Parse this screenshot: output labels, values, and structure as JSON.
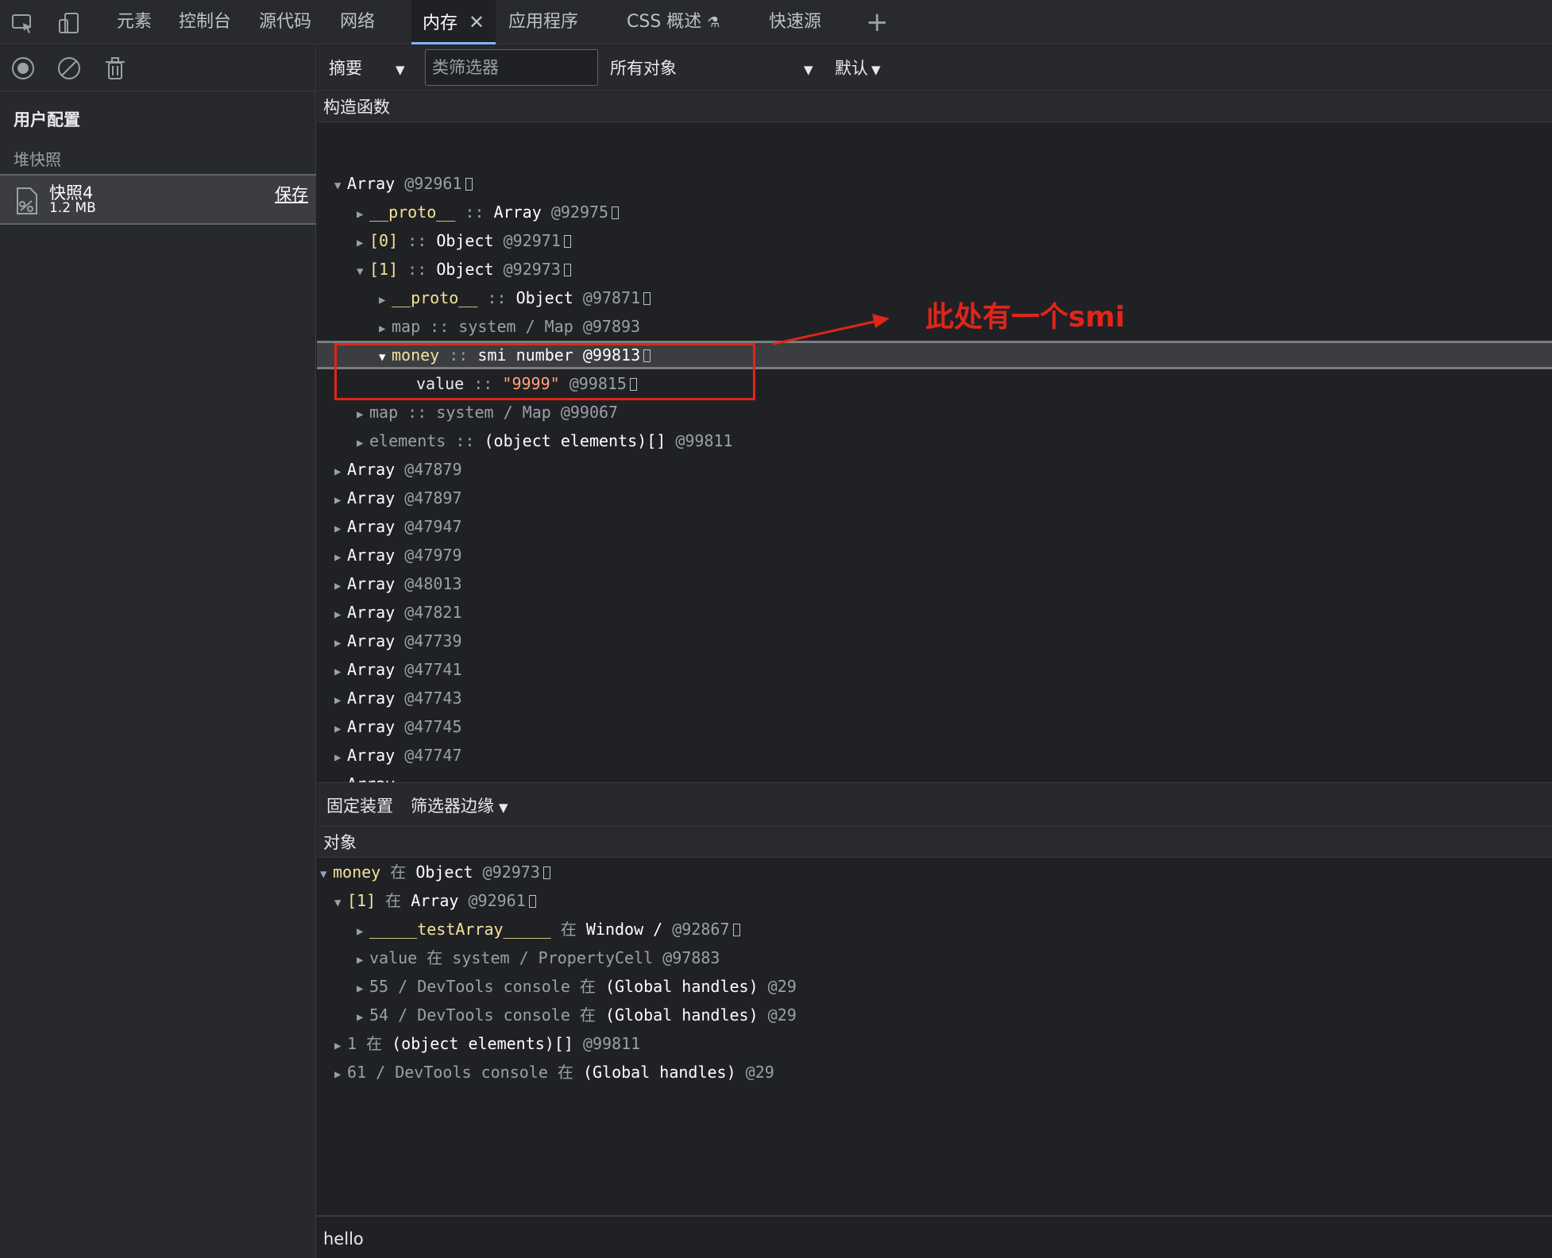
{
  "tabs": {
    "items": [
      "元素",
      "控制台",
      "源代码",
      "网络",
      "内存",
      "应用程序",
      "CSS 概述",
      "快速源"
    ],
    "active_index": 4,
    "close_glyph": "✕",
    "add_glyph": "+"
  },
  "sidebar": {
    "profiles_title": "用户配置",
    "heap_title": "堆快照",
    "snapshot_name": "快照4",
    "snapshot_size": "1.2 MB",
    "save_label": "保存"
  },
  "toolbar": {
    "view_label": "摘要",
    "class_filter_placeholder": "类筛选器",
    "objects_label": "所有对象",
    "default_label": "默认"
  },
  "constructors_header": "构造函数",
  "tree": {
    "array_root": {
      "name": "Array",
      "id": "@92961"
    },
    "proto": {
      "name": "__proto__",
      "sep": "::",
      "type": "Array",
      "id": "@92975"
    },
    "item0": {
      "name": "[0]",
      "sep": "::",
      "type": "Object",
      "id": "@92971"
    },
    "item1": {
      "name": "[1]",
      "sep": "::",
      "type": "Object",
      "id": "@92973"
    },
    "item1_proto": {
      "name": "__proto__",
      "sep": "::",
      "type": "Object",
      "id": "@97871"
    },
    "item1_map": {
      "text": "map :: system / Map",
      "id": "@97893"
    },
    "money": {
      "name": "money",
      "sep": "::",
      "type": "smi number",
      "id": "@99813"
    },
    "value": {
      "name": "value",
      "sep": "::",
      "val": "\"9999\"",
      "id": "@99815"
    },
    "map2": {
      "text": "map :: system / Map",
      "id": "@99067"
    },
    "elements": {
      "name": "elements",
      "sep": "::",
      "type": "(object elements)[]",
      "id": "@99811"
    },
    "arrays": [
      {
        "name": "Array",
        "id": "@47879"
      },
      {
        "name": "Array",
        "id": "@47897"
      },
      {
        "name": "Array",
        "id": "@47947"
      },
      {
        "name": "Array",
        "id": "@47979"
      },
      {
        "name": "Array",
        "id": "@48013"
      },
      {
        "name": "Array",
        "id": "@47821"
      },
      {
        "name": "Array",
        "id": "@47739"
      },
      {
        "name": "Array",
        "id": "@47741"
      },
      {
        "name": "Array",
        "id": "@47743"
      },
      {
        "name": "Array",
        "id": "@47745"
      },
      {
        "name": "Array",
        "id": "@47747"
      }
    ]
  },
  "annotation": {
    "text": "此处有一个smi",
    "color": "#e0251b"
  },
  "retainers": {
    "toolbar_left": "固定装置",
    "toolbar_right": "筛选器边缘",
    "header": "对象",
    "r0": {
      "name": "money",
      "in": "在",
      "type": "Object",
      "id": "@92973"
    },
    "r1": {
      "name": "[1]",
      "in": "在",
      "type": "Array",
      "id": "@92961"
    },
    "r2": {
      "name": "_____testArray_____",
      "in": "在",
      "type": "Window /",
      "id": "@92867"
    },
    "r3": {
      "text": "value 在 system / PropertyCell",
      "id": "@97883"
    },
    "r4": {
      "text": "55 / DevTools console 在",
      "type": "(Global handles)",
      "id": "@29"
    },
    "r5": {
      "text": "54 / DevTools console 在",
      "type": "(Global handles)",
      "id": "@29"
    },
    "r6": {
      "text": "1 在",
      "type": "(object elements)[]",
      "id": "@99811"
    },
    "r7": {
      "text": "61 / DevTools console 在",
      "type": "(Global handles)",
      "id": "@29"
    }
  },
  "console": {
    "value": "hello"
  },
  "colors": {
    "accent": "#8ab4f8",
    "annotation": "#e0251b",
    "yellow_key": "#f2e39b",
    "string": "#ffa37a"
  }
}
